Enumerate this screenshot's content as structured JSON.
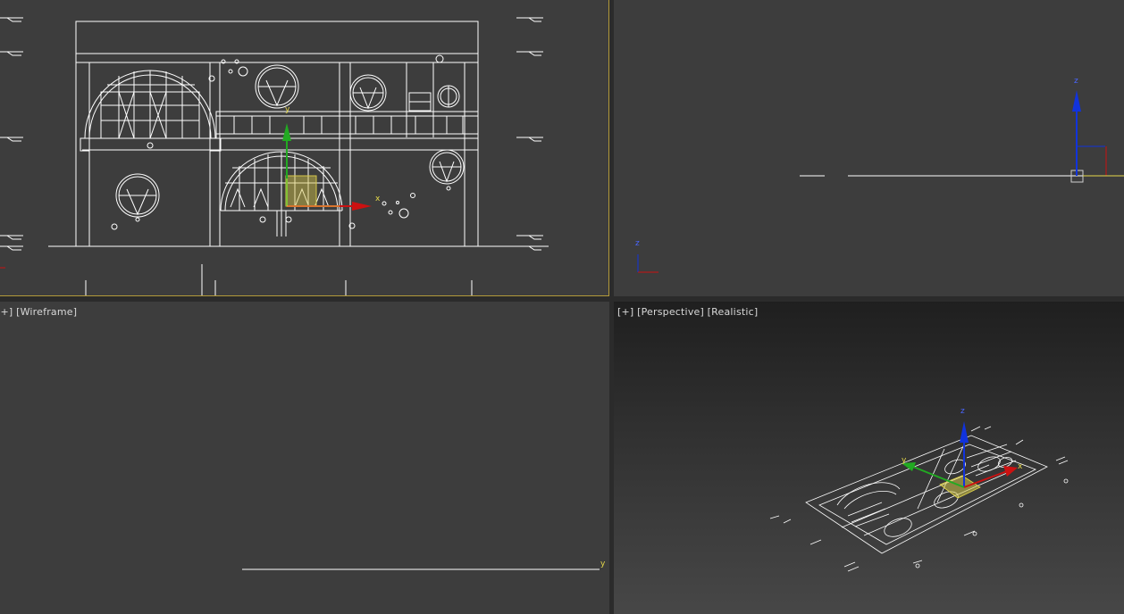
{
  "viewports": {
    "top_left": {
      "label": "",
      "gizmo": {
        "x_label": "x",
        "y_label": "y"
      }
    },
    "top_right": {
      "label": "",
      "axis_z": "z",
      "corner_z": "z"
    },
    "bottom_left": {
      "label": "[+] [Wireframe]",
      "axis_y": "y"
    },
    "bottom_right": {
      "label": "[+] [Perspective] [Realistic]",
      "gizmo": {
        "z_label": "z",
        "y_label": "y",
        "x_label": "x"
      }
    }
  },
  "colors": {
    "viewport_bg": "#3d3d3d",
    "active_border": "#b39a3a",
    "line": "#ffffff",
    "axis_x": "#cc1111",
    "axis_y": "#22aa22",
    "axis_z": "#1133dd",
    "selection": "#d6c84a"
  }
}
